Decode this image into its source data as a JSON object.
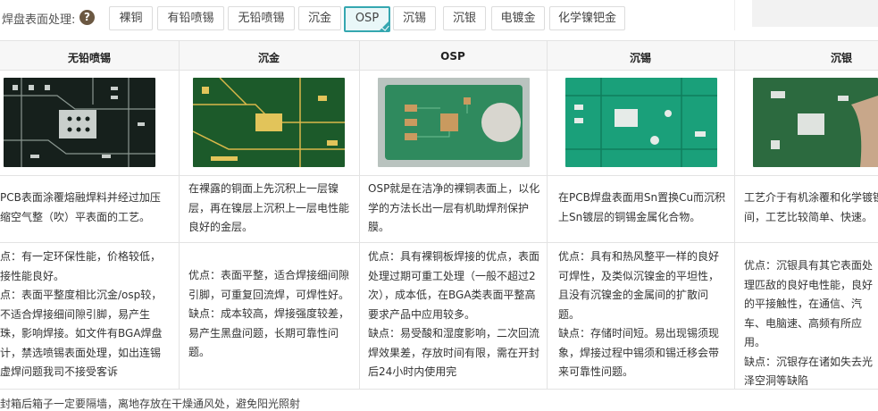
{
  "toolbar": {
    "label": "焊盘表面处理:",
    "help_glyph": "?",
    "options": [
      "裸铜",
      "有铅喷锡",
      "无铅喷锡",
      "沉金",
      "OSP",
      "沉锡",
      "沉银",
      "电镀金",
      "化学镍钯金"
    ],
    "selected": "OSP"
  },
  "table": {
    "columns": [
      {
        "title": "无铅喷锡",
        "description": "PCB表面涂覆熔融焊料并经过加压缩空气整（吹）平表面的工艺。",
        "proscons": "点：有一定环保性能，价格较低，接性能良好。\n点：表面平整度相比沉金/osp较，不适合焊接细间隙引脚，易产生珠，影响焊接。如文件有BGA焊盘计，禁选喷锡表面处理，如出连锡虚焊问题我司不接受客诉"
      },
      {
        "title": "沉金",
        "description": "在裸露的铜面上先沉积上一层镍层，再在镍层上沉积上一层电性能良好的金层。",
        "proscons": "优点：表面平整，适合焊接细间隙引脚，可重复回流焊，可焊性好。\n缺点：成本较高，焊接强度较差，易产生黑盘问题，长期可靠性问题。"
      },
      {
        "title": "OSP",
        "description": "OSP就是在洁净的裸铜表面上，以化学的方法长出一层有机助焊剂保护膜。",
        "proscons": "优点：具有裸铜板焊接的优点，表面处理过期可重工处理（一般不超过2次），成本低，在BGA类表面平整高要求产品中应用较多。\n缺点：易受酸和湿度影响，二次回流焊效果差，存放时间有限，需在开封后24小时内使用完"
      },
      {
        "title": "沉锡",
        "description": "在PCB焊盘表面用Sn置换Cu而沉积上Sn镀层的铜锡金属化合物。",
        "proscons": "优点：具有和热风整平一样的良好可焊性，及类似沉镍金的平坦性，且没有沉镍金的金属间的扩散问题。\n缺点：存储时间短。易出现锡须现象，焊接过程中锡须和锡迁移会带来可靠性问题。"
      },
      {
        "title": "沉银",
        "description": "工艺介于有机涂覆和化学镀镍之间，工艺比较简单、快速。",
        "proscons": "优点：沉银具有其它表面处理匹敌的良好电性能，良好的平接触性，在通信、汽车、电脑速、高频有所应用。\n缺点：沉银存在诸如失去光泽空洞等缺陷"
      }
    ]
  },
  "footer": {
    "note": "封箱后箱子一定要隔墙，离地存放在干燥通风处，避免阳光照射"
  },
  "colors": {
    "accent": "#35a7b0",
    "help_bg": "#6b5842",
    "pcb_green": "#1f7a3c"
  }
}
